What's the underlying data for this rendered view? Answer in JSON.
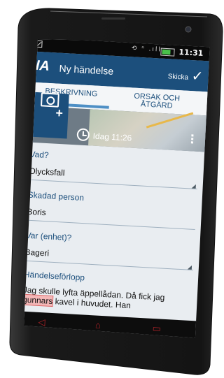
{
  "status_bar": {
    "signal_icons": "⟲ ⁿ .ıll",
    "time": "11:31"
  },
  "app_bar": {
    "logo": "IA",
    "title": "Ny händelse",
    "send_label": "Skicka",
    "back_glyph": "‹",
    "check_glyph": "✓"
  },
  "tabs": [
    {
      "label": "BESKRIVNING",
      "active": true
    },
    {
      "label": "ORSAK OCH ÅTGÄRD",
      "active": false
    }
  ],
  "header": {
    "datetime": "Idag 11:26"
  },
  "form": {
    "fields": [
      {
        "label": "Vad?",
        "value": "Olycksfall",
        "dropdown": true
      },
      {
        "label": "Skadad person",
        "value": "Boris",
        "dropdown": false
      },
      {
        "label": "Var (enhet)?",
        "value": "Bageri",
        "dropdown": true
      }
    ],
    "description": {
      "label": "Händelseförlopp",
      "text_before": "Jag skulle lyfta äppellådan. Då fick jag ",
      "highlight": "gunnars",
      "text_after": " kavel i huvudet. Han"
    }
  },
  "colors": {
    "app_bar": "#1c4f7c",
    "accent": "#4e8fc5",
    "nav_icons": "#b8242a"
  },
  "nav": {
    "back_glyph": "◁",
    "home_glyph": "⌂",
    "recent_glyph": "▭"
  }
}
